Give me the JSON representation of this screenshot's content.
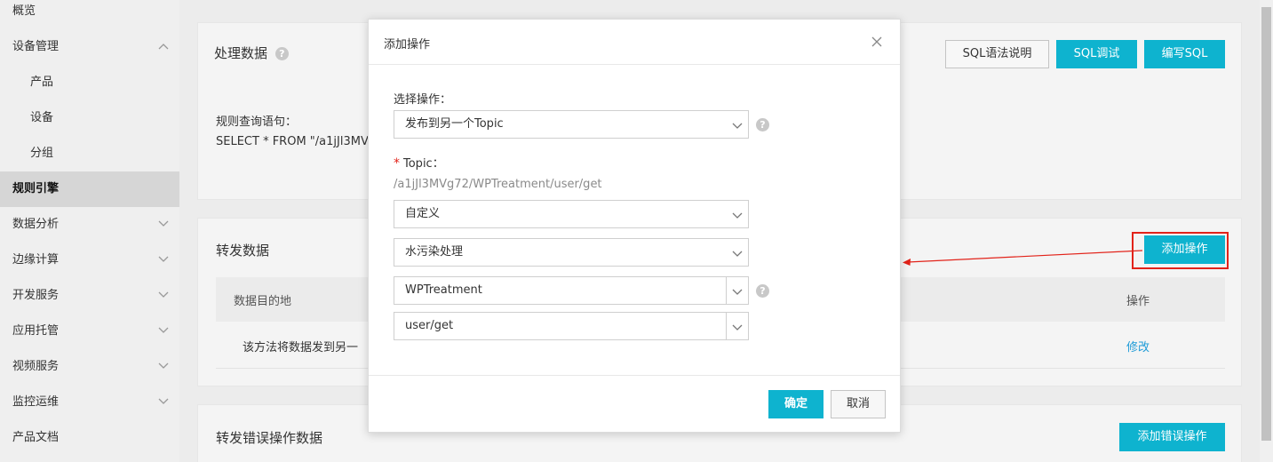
{
  "sidebar": {
    "items": [
      {
        "label": "概览",
        "type": "top"
      },
      {
        "label": "设备管理",
        "type": "top",
        "expanded": true
      },
      {
        "label": "产品",
        "type": "sub"
      },
      {
        "label": "设备",
        "type": "sub"
      },
      {
        "label": "分组",
        "type": "sub"
      },
      {
        "label": "规则引擎",
        "type": "top",
        "active": true
      },
      {
        "label": "数据分析",
        "type": "top"
      },
      {
        "label": "边缘计算",
        "type": "top"
      },
      {
        "label": "开发服务",
        "type": "top"
      },
      {
        "label": "应用托管",
        "type": "top"
      },
      {
        "label": "视频服务",
        "type": "top"
      },
      {
        "label": "监控运维",
        "type": "top"
      },
      {
        "label": "产品文档",
        "type": "top"
      }
    ]
  },
  "process_card": {
    "title": "处理数据",
    "help": "?",
    "buttons": {
      "sql_help": "SQL语法说明",
      "sql_debug": "SQL调试",
      "write_sql": "编写SQL"
    },
    "query_label": "规则查询语句：",
    "query_text": "SELECT * FROM \"/a1jJl3MV"
  },
  "forward_card": {
    "title": "转发数据",
    "add_button": "添加操作",
    "table": {
      "col_dest": "数据目的地",
      "col_action": "操作",
      "row_desc": "该方法将数据发到另一",
      "row_action": "修改"
    }
  },
  "error_card": {
    "title": "转发错误操作数据",
    "add_button": "添加错误操作"
  },
  "modal": {
    "title": "添加操作",
    "close": "×",
    "select_label": "选择操作：",
    "select_value": "发布到另一个Topic",
    "topic_label": "Topic：",
    "topic_required": "*",
    "topic_path": "/a1jJl3MVg72/WPTreatment/user/get",
    "topic_type": "自定义",
    "product": "水污染处理",
    "device": "WPTreatment",
    "topic_suffix": "user/get",
    "confirm": "确定",
    "cancel": "取消"
  },
  "colors": {
    "primary": "#0eb3cf",
    "annotation_red": "#e2231a",
    "link": "#1e9bd7"
  }
}
